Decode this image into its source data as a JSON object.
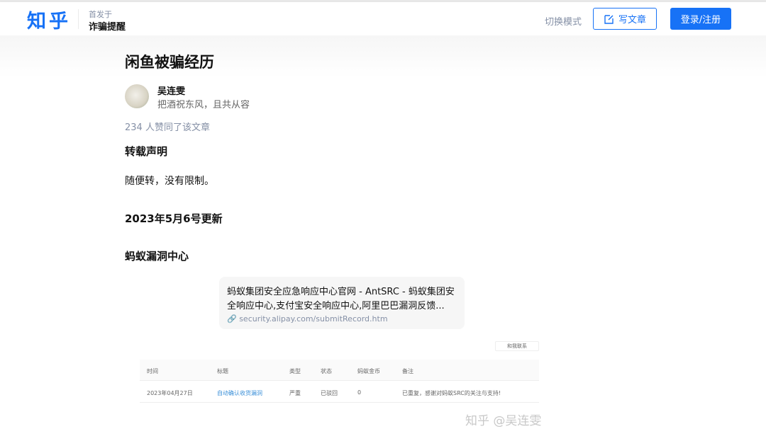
{
  "header": {
    "logo": "知乎",
    "published_in_label": "首发于",
    "column": "诈骗提醒",
    "switch_mode": "切换模式",
    "write_article": "写文章",
    "login": "登录/注册",
    "accent": "#1772f6"
  },
  "article": {
    "title": "闲鱼被骗经历",
    "author": "吴连雯",
    "bio": "把酒祝东风，且共从容",
    "votes": "234 人赞同了该文章",
    "h1": "转载声明",
    "p1": "随便转，没有限制。",
    "h2": "2023年5月6号更新",
    "h3": "蚂蚁漏洞中心",
    "card": {
      "title": "蚂蚁集团安全应急响应中心官网 - AntSRC - 蚂蚁集团安全响应中心,支付宝安全响应中心,阿里巴巴漏洞反馈...",
      "url": "security.alipay.com/submitRecord.htm"
    },
    "screenshot": {
      "button": "和我联系",
      "headers": [
        "时间",
        "标题",
        "类型",
        "状态",
        "蚂蚁金币",
        "备注"
      ],
      "row": [
        "2023年04月27日",
        "自动确认收货漏洞",
        "严重",
        "已驳回",
        "0",
        "已重复，感谢对蚂蚁SRC的关注与支持!"
      ]
    },
    "watermark": "知乎 @吴连雯"
  }
}
